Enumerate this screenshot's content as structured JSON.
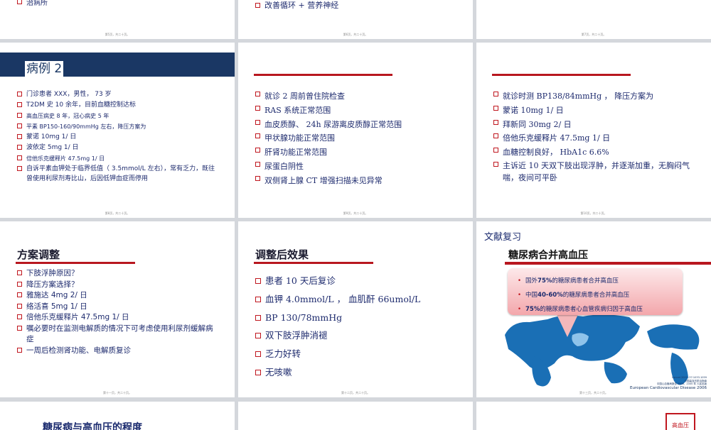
{
  "slides": {
    "top_left": {
      "partial_text": "治病所",
      "footer": "第5页，共二十页。"
    },
    "top_mid": {
      "partial_text": "改善循环 + 营养神经",
      "footer": "第6页，共二十页。"
    },
    "top_right": {
      "footer": "第7页，共二十页。"
    },
    "s8": {
      "title": "病例 2",
      "items": [
        "门诊患者 XXX，男性， 73 岁",
        "T2DM 史 10 余年，目前血糖控制达标",
        "高血压病史 8 年，冠心病史 5 年",
        "平素 BP150-160/90mmHg 左右，降压方案为",
        "蒙诺 10mg 1/ 日",
        "波依定 5mg 1/ 日",
        "倍他乐克缓释片  47.5mg 1/ 日",
        "自诉平素血钾处于临界低值（ 3.5mmol/L 左右），常有乏力，既往曾使用利尿剂寿比山，后因低钾血症而停用"
      ],
      "footer": "第8页，共二十页。"
    },
    "s9": {
      "items": [
        "就诊 2 周前曾住院检查",
        "RAS 系统正常范围",
        "血皮质醇、 24h 尿游离皮质醇正常范围",
        "甲状腺功能正常范围",
        "肝肾功能正常范围",
        "尿蛋白阴性",
        "双侧肾上腺 CT 增强扫描未见异常"
      ],
      "footer": "第9页，共二十页。"
    },
    "s10": {
      "items": [
        "就诊时测 BP138/84mmHg ， 降压方案为",
        "蒙诺 10mg 1/ 日",
        "拜新同   30mg 2/ 日",
        "倍他乐克缓释片    47.5mg 1/ 日",
        "血糖控制良好，  HbA1c 6.6%",
        "主诉近 10 天双下肢出现浮肿，并逐渐加重，无胸闷气喘，夜间可平卧"
      ],
      "footer": "第10页，共二十页。"
    },
    "s11": {
      "title": "方案调整",
      "items": [
        "下肢浮肿原因？",
        "降压方案选择？",
        "雅施达   4mg 2/ 日",
        "络活喜   5mg 1/ 日",
        "倍他乐克缓释片   47.5mg 1/ 日",
        "嘱必要时在监测电解质的情况下可考虑使用利尿剂缓解病症",
        "一周后检测肾功能、电解质复诊"
      ],
      "footer": "第十一页，共二十页。"
    },
    "s12": {
      "title": "调整后效果",
      "items": [
        "患者 10 天后复诊",
        "血钾 4.0mmol/L ，  血肌酐 66umol/L",
        "BP 130/78mmHg",
        "双下肢浮肿消褪",
        "乏力好转",
        "无咳嗽"
      ],
      "footer": "第十二页，共二十页。"
    },
    "s13": {
      "kicker": "文献复习",
      "title": "糖尿病合并高血压",
      "callout": [
        {
          "pre": "国外 ",
          "strong": "75%",
          "post": " 的糖尿病患者合并高血压"
        },
        {
          "pre": "中国 ",
          "strong": "40-60%",
          "post": " 的糖尿病患者合并高血压"
        },
        {
          "pre": "",
          "strong": "75%",
          "post": " 的糖尿病患者心血管疾病归因于高血压"
        }
      ],
      "citation_small": "Lancet 2001 ;37:1033-1059\n中国高血压防治指南\n中国心血管病报告 2006，2005 年 人民出版",
      "citation_main": "European Cardiovascular Disease 2006",
      "footer": "第十三页，共二十页。"
    },
    "bottom_left": {
      "partial_title": "糖尿病与高血压的程度"
    },
    "bottom_right": {
      "badge": "高血压"
    }
  }
}
